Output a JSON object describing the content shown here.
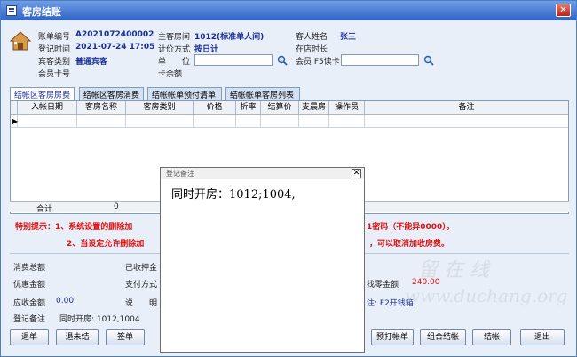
{
  "window": {
    "title": "客房结账",
    "close_glyph": "✕"
  },
  "header": {
    "account_no_label": "账单编号",
    "account_no": "A2021072400002",
    "reg_time_label": "登记时间",
    "reg_time": "2021-07-24 17:05",
    "guest_type_label": "宾客类别",
    "guest_type": "普通宾客",
    "member_card_label": "会员卡号",
    "main_room_label": "主客房间",
    "main_room": "1012(标准单人间)",
    "pricing_label": "计价方式",
    "pricing": "按日计",
    "unit_label": "单　　位",
    "card_balance_label": "卡余额",
    "guest_name_label": "客人姓名",
    "guest_name": "张三",
    "stay_label": "在店时长",
    "member_f5_label": "会员 F5读卡"
  },
  "tabs": [
    {
      "label": "结帐区客房房费"
    },
    {
      "label": "结帐区客房消费"
    },
    {
      "label": "结帐帐单预付清单"
    },
    {
      "label": "结帐帐单客房列表"
    }
  ],
  "grid": {
    "columns": [
      "入帐日期",
      "客房名称",
      "客房类别",
      "价格",
      "折率",
      "结算价",
      "支晨房",
      "操作员",
      "备注"
    ],
    "row_marker": "▶",
    "total_label": "合计",
    "total_value": "0"
  },
  "warnings": {
    "line1_prefix": "特别提示：1、系统设置的删除加",
    "line1_suffix": "1密码（不能异0000）。",
    "line2_prefix": "2、当设定允许删除加",
    "line2_suffix": "，可以取消加收房费。"
  },
  "summary": {
    "consumption_label": "消费总额",
    "deposit_label": "已收押金",
    "discount_label": "优惠金额",
    "pay_method_label": "支付方式",
    "due_label": "应收金额",
    "due_value": "0.00",
    "notes_label": "说　　明",
    "remark_label": "登记备注",
    "remark_value": "同时开房: 1012,1004",
    "change_label": "找零金额",
    "change_value": "240.00",
    "note_f2": "注: F2开钱箱"
  },
  "buttons": [
    "退单",
    "退未结",
    "签单",
    "预打帐单",
    "组合结帐",
    "结帐",
    "退出"
  ],
  "popup": {
    "title": "登记备注",
    "close": "✕",
    "text": "同时开房：1012;1004,"
  },
  "watermark": {
    "cn": "留 在 线",
    "en": "www.duchang.org"
  }
}
